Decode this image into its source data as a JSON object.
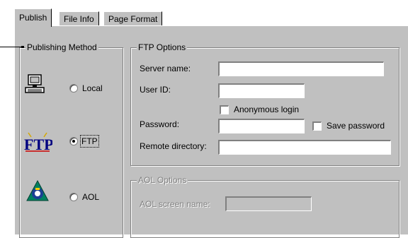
{
  "tabs": [
    {
      "label": "Publish",
      "active": true
    },
    {
      "label": "File Info",
      "active": false
    },
    {
      "label": "Page Format",
      "active": false
    }
  ],
  "publishing_method": {
    "title": "Publishing Method",
    "options": [
      {
        "label": "Local",
        "icon": "computer-icon",
        "selected": false
      },
      {
        "label": "FTP",
        "icon": "ftp-logo-icon",
        "selected": true
      },
      {
        "label": "AOL",
        "icon": "aol-logo-icon",
        "selected": false
      }
    ]
  },
  "ftp_options": {
    "title": "FTP Options",
    "server_name_label": "Server name:",
    "server_name_value": "",
    "user_id_label": "User ID:",
    "user_id_value": "",
    "anonymous_label": "Anonymous login",
    "anonymous_checked": false,
    "password_label": "Password:",
    "password_value": "",
    "save_password_label": "Save password",
    "save_password_checked": false,
    "remote_directory_label": "Remote directory:",
    "remote_directory_value": ""
  },
  "aol_options": {
    "title": "AOL Options",
    "screen_name_label": "AOL screen name:",
    "screen_name_value": "",
    "enabled": false
  },
  "colors": {
    "face": "#c0c0c0",
    "shadow": "#808080",
    "highlight": "#ffffff",
    "ftp_logo_blue": "#000080",
    "ftp_logo_red": "#cc0000",
    "aol_green": "#008060"
  }
}
